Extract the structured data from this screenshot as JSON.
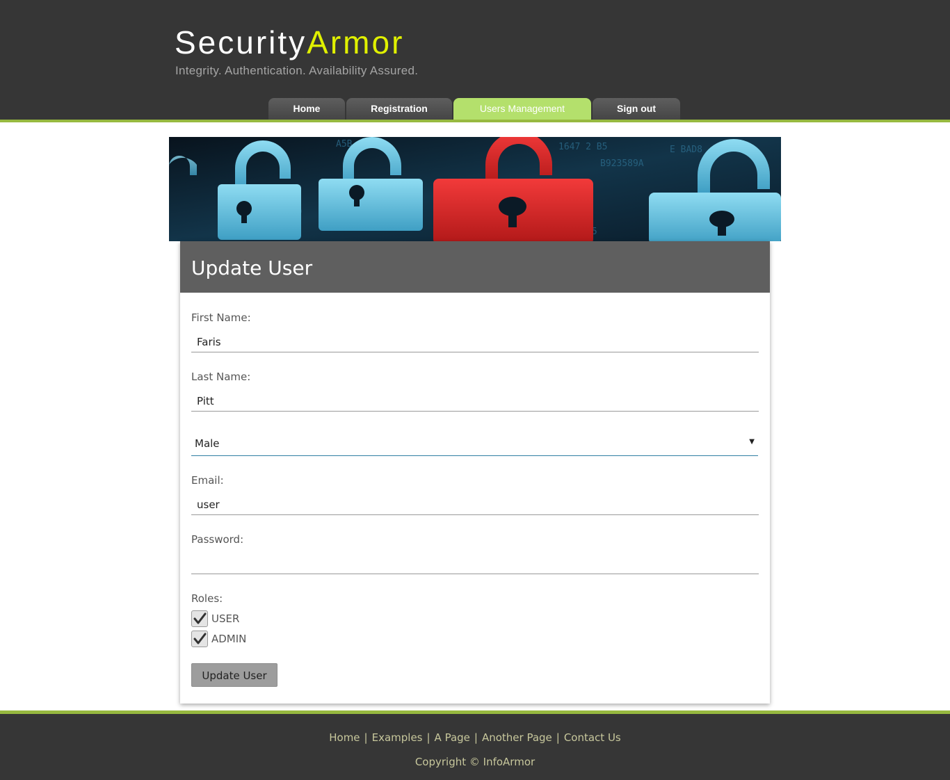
{
  "brand": {
    "name_part1": "Security",
    "name_part2": "Armor",
    "tagline": "Integrity. Authentication. Availability Assured."
  },
  "nav": {
    "tabs": [
      {
        "label": "Home",
        "active": false
      },
      {
        "label": "Registration",
        "active": false
      },
      {
        "label": "Users Management",
        "active": true
      },
      {
        "label": "Sign out",
        "active": false
      }
    ]
  },
  "form": {
    "title": "Update User",
    "first_name_label": "First Name:",
    "first_name_value": "Faris",
    "last_name_label": "Last Name:",
    "last_name_value": "Pitt",
    "gender_value": "Male",
    "email_label": "Email:",
    "email_value": "user",
    "password_label": "Password:",
    "password_value": "",
    "roles_label": "Roles:",
    "roles": [
      {
        "label": "USER",
        "checked": true
      },
      {
        "label": "ADMIN",
        "checked": true
      }
    ],
    "submit_label": "Update User"
  },
  "footer": {
    "links": [
      "Home",
      "Examples",
      "A Page",
      "Another Page",
      "Contact Us"
    ],
    "copyright": "Copyright © InfoArmor"
  },
  "colors": {
    "header_bg": "#363636",
    "accent_green": "#97b940",
    "active_tab": "#b4e06c",
    "brand_yellow": "#e0f000"
  },
  "icons": {
    "dropdown": "chevron-down-icon",
    "checkbox": "checkmark-icon"
  }
}
